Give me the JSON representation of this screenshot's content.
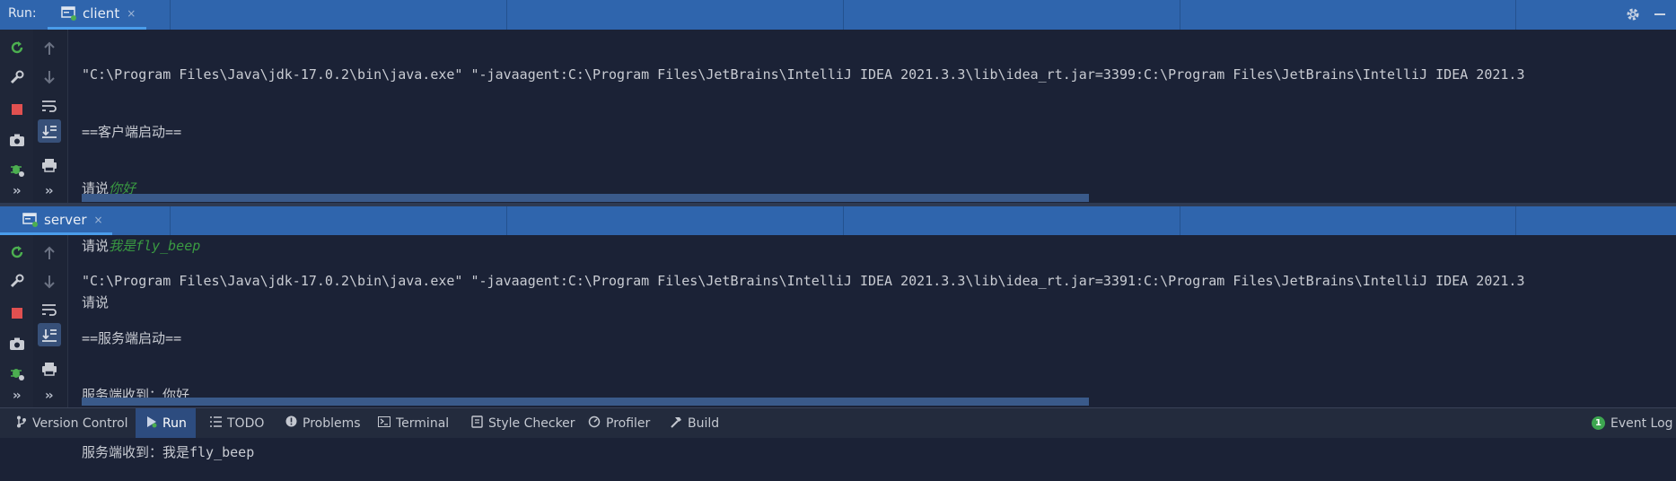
{
  "run_panel": {
    "label": "Run:",
    "client_tab": {
      "label": "client",
      "close": "×"
    },
    "server_tab": {
      "label": "server",
      "close": "×"
    }
  },
  "client_console": {
    "cmd": "\"C:\\Program Files\\Java\\jdk-17.0.2\\bin\\java.exe\" \"-javaagent:C:\\Program Files\\JetBrains\\IntelliJ IDEA 2021.3.3\\lib\\idea_rt.jar=3399:C:\\Program Files\\JetBrains\\IntelliJ IDEA 2021.3",
    "banner": "==客户端启动==",
    "prompt1": "请说",
    "input1": "你好",
    "prompt2": "请说",
    "input2": "我是fly_beep",
    "prompt3": "请说"
  },
  "server_console": {
    "cmd": "\"C:\\Program Files\\Java\\jdk-17.0.2\\bin\\java.exe\" \"-javaagent:C:\\Program Files\\JetBrains\\IntelliJ IDEA 2021.3.3\\lib\\idea_rt.jar=3391:C:\\Program Files\\JetBrains\\IntelliJ IDEA 2021.3",
    "banner": "==服务端启动==",
    "line1": "服务端收到：你好",
    "line2": "服务端收到：我是fly_beep"
  },
  "toolbar_buttons": {
    "more": "››"
  },
  "bottom_bar": {
    "version_control": "Version Control",
    "run": "Run",
    "todo": "TODO",
    "problems": "Problems",
    "terminal": "Terminal",
    "style_checker": "Style Checker",
    "profiler": "Profiler",
    "build": "Build",
    "event_log_count": "1",
    "event_log": "Event Log"
  },
  "colors": {
    "tab_bar": "#2f65ad",
    "console_bg": "#1b2236",
    "user_input": "#3a9a42",
    "rerun_green": "#4caf50",
    "stop_red": "#e05050"
  }
}
